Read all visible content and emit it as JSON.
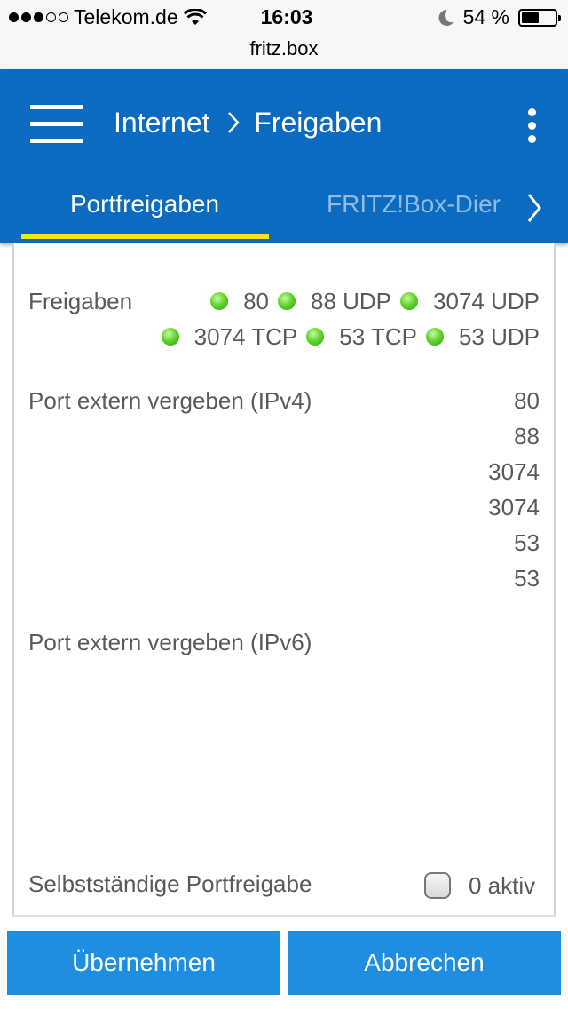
{
  "status_bar": {
    "carrier": "Telekom.de",
    "time": "16:03",
    "battery_percent": "54 %",
    "battery_level": 0.54,
    "signal_bars_filled": 3,
    "signal_bars_total": 5
  },
  "browser": {
    "url": "fritz.box"
  },
  "header": {
    "breadcrumb_section": "Internet",
    "breadcrumb_page": "Freigaben",
    "tabs": [
      {
        "label": "Portfreigaben",
        "active": true
      },
      {
        "label": "FRITZ!Box-Dier",
        "active": false
      }
    ]
  },
  "content": {
    "freigaben_label": "Freigaben",
    "freigaben_row1": [
      "80",
      "88 UDP",
      "3074 UDP"
    ],
    "freigaben_row2": [
      "3074 TCP",
      "53 TCP",
      "53 UDP"
    ],
    "ipv4_label": "Port extern vergeben (IPv4)",
    "ipv4_ports": [
      "80",
      "88",
      "3074",
      "3074",
      "53",
      "53"
    ],
    "ipv6_label": "Port extern vergeben (IPv6)",
    "self_label": "Selbstständige Portfreigabe",
    "self_count": "0 aktiv"
  },
  "buttons": {
    "apply": "Übernehmen",
    "cancel": "Abbrechen"
  },
  "colors": {
    "header_bg": "#0b6bc0",
    "tab_underline": "#f1e817",
    "button_bg": "#1f8ee0",
    "status_led": "#62d62b"
  }
}
